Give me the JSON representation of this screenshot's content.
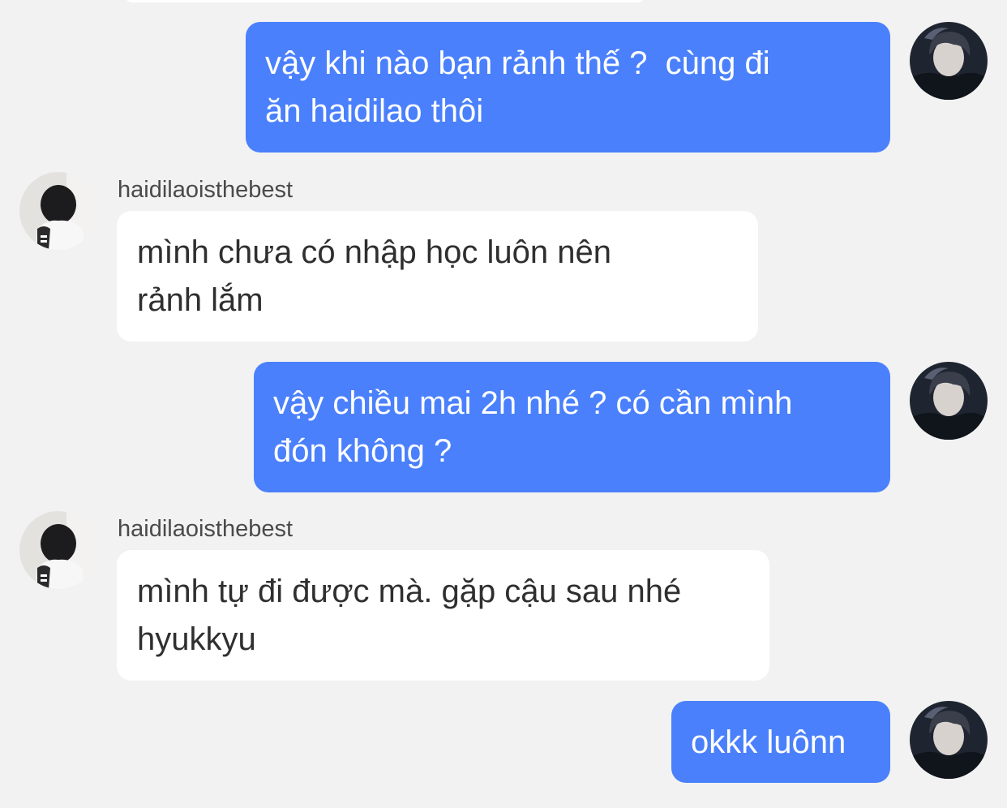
{
  "colors": {
    "background": "#f2f2f2",
    "outgoing_bubble": "#4a80fc",
    "incoming_bubble": "#ffffff",
    "outgoing_text": "#ffffff",
    "incoming_text": "#2f2f2f",
    "sender_text": "#4a4a4a"
  },
  "messages": [
    {
      "direction": "outgoing",
      "text": "vậy khi nào bạn rảnh thế ?  cùng đi\năn haidilao thôi"
    },
    {
      "direction": "incoming",
      "sender": "haidilaoisthebest",
      "text": "mình chưa có nhập học luôn nên\nrảnh lắm"
    },
    {
      "direction": "outgoing",
      "text": "vậy chiều mai 2h nhé ? có cần mình\nđón không ?"
    },
    {
      "direction": "incoming",
      "sender": "haidilaoisthebest",
      "text": "mình tự đi được mà. gặp cậu sau nhé\nhyukkyu"
    },
    {
      "direction": "outgoing",
      "text": "okkk luônn"
    }
  ]
}
